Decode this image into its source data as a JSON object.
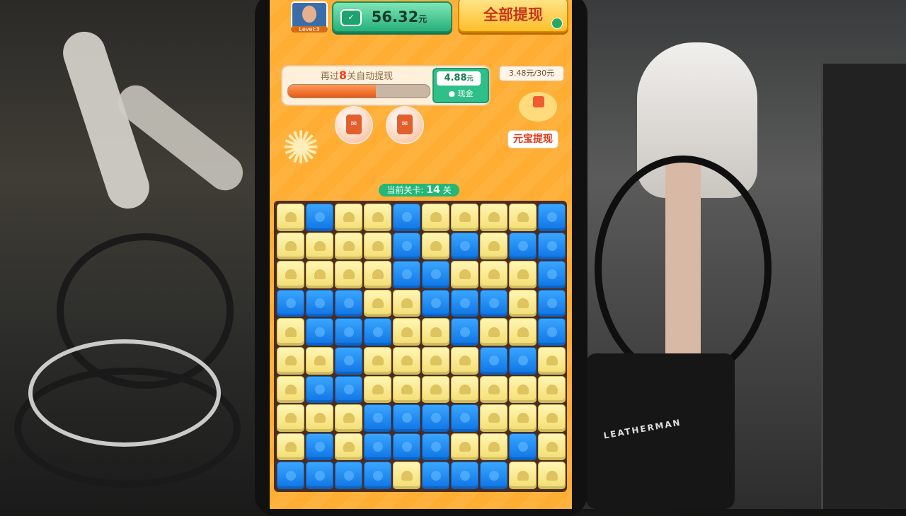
{
  "header": {
    "avatar_level": "Level:3",
    "balance_value": "56.32",
    "balance_unit": "元",
    "withdraw_all_label": "全部提现"
  },
  "progress": {
    "prefix": "再过",
    "remaining": "8",
    "suffix": "关自动提现",
    "fill_fraction": 0.62,
    "cash_value": "4.88",
    "cash_unit": "元",
    "cash_label": "现金"
  },
  "ingot": {
    "target_text": "3.48元/30元",
    "button_label": "元宝提现"
  },
  "level_indicator": {
    "label": "当前关卡:",
    "value": "14",
    "unit": "关"
  },
  "board": {
    "rows": [
      "ybyybyyyyb",
      "yyyybybybb",
      "yyyybbyyyb",
      "bbbyybbbyb",
      "ybbbyybyyb",
      "yybyyyybby",
      "ybbyyyyyyy",
      "yyybbbbyyy",
      "ybybbbyyby",
      "bbbbybbbyy"
    ]
  },
  "colors": {
    "tile_yellow": "#f3dd72",
    "tile_blue": "#0e74e4",
    "accent_green": "#27b07a",
    "accent_red": "#e1381a"
  }
}
